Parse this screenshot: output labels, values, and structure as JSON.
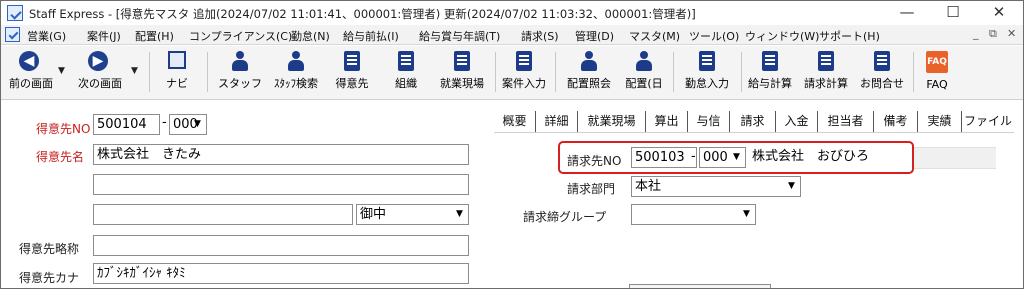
{
  "window": {
    "title": "Staff Express - [得意先マスタ  追加(2024/07/02 11:01:41、000001:管理者)  更新(2024/07/02 11:03:32、000001:管理者)]",
    "minimize": "—",
    "maximize": "☐",
    "close": "✕"
  },
  "menu": {
    "items": [
      "営業(G)",
      "案件(J)",
      "配置(H)",
      "コンプライアンス(C)",
      "勤怠(N)",
      "給与前払(I)",
      "給与賞与年調(T)",
      "請求(S)",
      "管理(D)",
      "マスタ(M)",
      "ツール(O)",
      "ウィンドウ(W)",
      "サポート(H)"
    ],
    "mdi": [
      "_",
      "⧉",
      "✕"
    ]
  },
  "toolbar": {
    "back": "前の画面",
    "forward": "次の画面",
    "navi": "ナビ",
    "buttons": [
      "スタッフ",
      "ｽﾀｯﾌ検索",
      "得意先",
      "組織",
      "就業現場",
      "案件入力",
      "配置照会",
      "配置(日",
      "勤怠入力",
      "給与計算",
      "請求計算",
      "お問合せ",
      "FAQ"
    ]
  },
  "left_form": {
    "code_label": "得意先NO",
    "code_value": "500104",
    "code_branch": "000",
    "name_label": "得意先名",
    "name_value": "株式会社　きたみ",
    "name2_value": "",
    "name3_value": "",
    "honorific": "御中",
    "short_label": "得意先略称",
    "short_value": "",
    "kana_label": "得意先カナ",
    "kana_value": "ｶﾌﾞｼｷｶﾞｲｼｬ ｷﾀﾐ"
  },
  "tabs": [
    "概要",
    "詳細",
    "就業現場",
    "算出",
    "与信",
    "請求",
    "入金",
    "担当者",
    "備考",
    "実績",
    "ファイル"
  ],
  "active_tab": "請求",
  "billing": {
    "billto_label": "請求先NO",
    "billto_value": "500103",
    "billto_branch": "000",
    "billto_name": "株式会社　おびひろ",
    "dept_label": "請求部門",
    "dept_value": "本社",
    "group_label": "請求締グループ",
    "group_value": ""
  },
  "icons": {
    "back": "arrow-left-circle-icon",
    "forward": "arrow-right-circle-icon",
    "dropdown": "chevron-down-icon"
  },
  "colors": {
    "required_label": "#c81e1e",
    "highlight": "#d81e1e",
    "icon_navy": "#1c3c8a",
    "faq": "#e8622a"
  }
}
